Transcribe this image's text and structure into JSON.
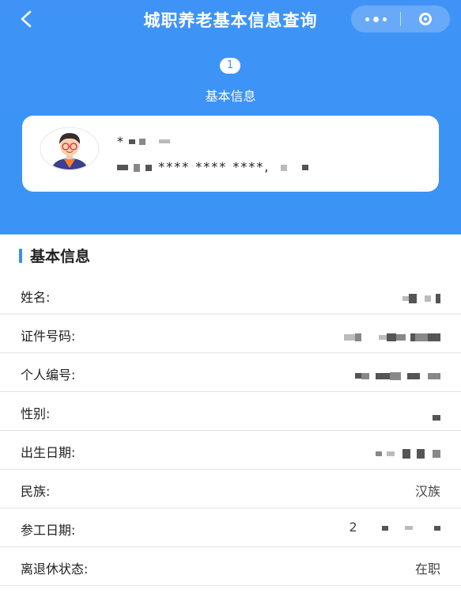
{
  "navbar": {
    "title": "城职养老基本信息查询",
    "back_icon": "chevron-left-icon",
    "more_icon": "more-dots-icon",
    "close_icon": "target-icon"
  },
  "step": {
    "number": "1",
    "label": "基本信息"
  },
  "card": {
    "name_masked": "*",
    "id_masked": "**** **** ****,"
  },
  "section": {
    "title": "基本信息",
    "accent_color": "#3a8ff2",
    "rows": [
      {
        "label": "姓名:",
        "value": ""
      },
      {
        "label": "证件号码:",
        "value": ""
      },
      {
        "label": "个人编号:",
        "value": ""
      },
      {
        "label": "性别:",
        "value": ""
      },
      {
        "label": "出生日期:",
        "value": ""
      },
      {
        "label": "民族:",
        "value": "汉族"
      },
      {
        "label": "参工日期:",
        "value": "2"
      },
      {
        "label": "离退休状态:",
        "value": "在职"
      }
    ]
  },
  "colors": {
    "header_blue": "#3a93f5",
    "text": "#222222"
  }
}
